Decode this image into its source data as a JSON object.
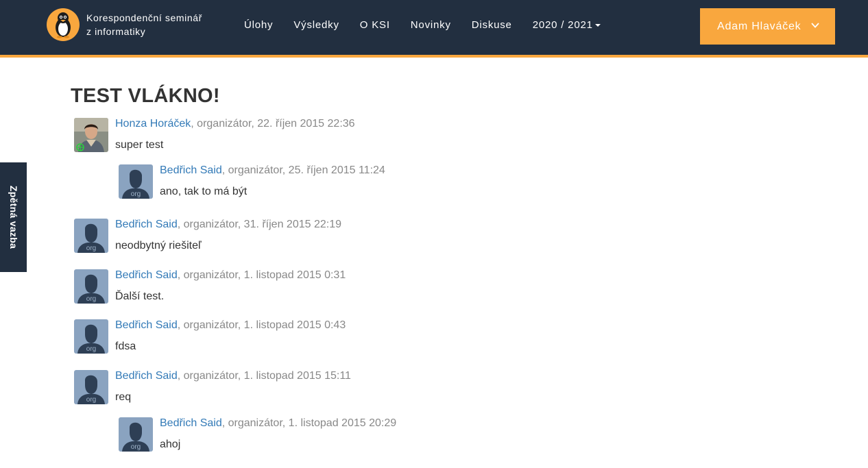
{
  "brand": {
    "line1": "Korespondenční seminář",
    "line2": "z informatiky"
  },
  "nav": {
    "items": [
      "Úlohy",
      "Výsledky",
      "O KSI",
      "Novinky",
      "Diskuse"
    ],
    "year": "2020 / 2021"
  },
  "user": {
    "name": "Adam Hlaváček"
  },
  "feedback": {
    "label": "Zpětná vazba"
  },
  "thread": {
    "title": "TEST VLÁKNO!",
    "posts": [
      {
        "author": "Honza Horáček",
        "meta": ", organizátor, 22. říjen 2015 22:36",
        "text": "super test",
        "avatar": "photo-avatar"
      },
      {
        "author": "Bedřich Said",
        "meta": ", organizátor, 25. říjen 2015 11:24",
        "text": "ano, tak to má být",
        "avatar": "org-avatar",
        "avatar_label": "org"
      },
      {
        "author": "Bedřich Said",
        "meta": ", organizátor, 31. říjen 2015 22:19",
        "text": "neodbytný riešiteľ",
        "avatar": "org-avatar",
        "avatar_label": "org"
      },
      {
        "author": "Bedřich Said",
        "meta": ", organizátor, 1. listopad 2015 0:31",
        "text": "Ďalší test.",
        "avatar": "org-avatar",
        "avatar_label": "org"
      },
      {
        "author": "Bedřich Said",
        "meta": ", organizátor, 1. listopad 2015 0:43",
        "text": "fdsa",
        "avatar": "org-avatar",
        "avatar_label": "org"
      },
      {
        "author": "Bedřich Said",
        "meta": ", organizátor, 1. listopad 2015 15:11",
        "text": "req",
        "avatar": "org-avatar",
        "avatar_label": "org"
      },
      {
        "author": "Bedřich Said",
        "meta": ", organizátor, 1. listopad 2015 20:29",
        "text": "ahoj",
        "avatar": "org-avatar",
        "avatar_label": "org"
      }
    ]
  },
  "colors": {
    "navbar": "#222f40",
    "accent": "#f9a73e",
    "link": "#337ab7",
    "muted": "#888888"
  }
}
